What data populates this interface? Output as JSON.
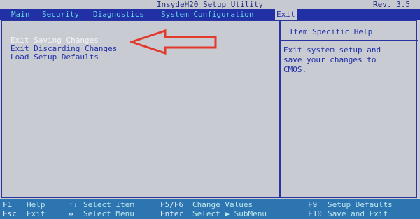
{
  "header": {
    "title": "InsydeH20 Setup Utility",
    "revision": "Rev. 3.5"
  },
  "menu": {
    "main": "Main",
    "security": "Security",
    "diagnostics": "Diagnostics",
    "system_configuration": "System Configuration",
    "exit": "Exit"
  },
  "options": {
    "exit_saving": "Exit Saving Changes",
    "exit_discarding": "Exit Discarding Changes",
    "load_defaults": "Load Setup Defaults"
  },
  "help": {
    "header": "Item Specific Help",
    "line1": "Exit system setup and",
    "line2": "save your changes to",
    "line3": "CMOS."
  },
  "statusbar": {
    "r1": {
      "f1_key": "F1",
      "f1_label": "Help",
      "updown_key": "↑↓",
      "updown_label": "Select Item",
      "f5f6_key": "F5/F6",
      "f5f6_label": "Change Values",
      "f9_key": "F9",
      "f9_label": "Setup Defaults"
    },
    "r2": {
      "esc_key": "Esc",
      "esc_label": "Exit",
      "leftright_key": "↔",
      "leftright_label": "Select Menu",
      "enter_key": "Enter",
      "enter_label": "Select ▶ SubMenu",
      "f10_key": "F10",
      "f10_label": "Save and Exit"
    }
  },
  "colors": {
    "background": "#c9cbd2",
    "menubar": "#2230a6",
    "menu_text": "#67d9e6",
    "status_bg": "#2d75b0",
    "arrow": "#e23b2e"
  }
}
